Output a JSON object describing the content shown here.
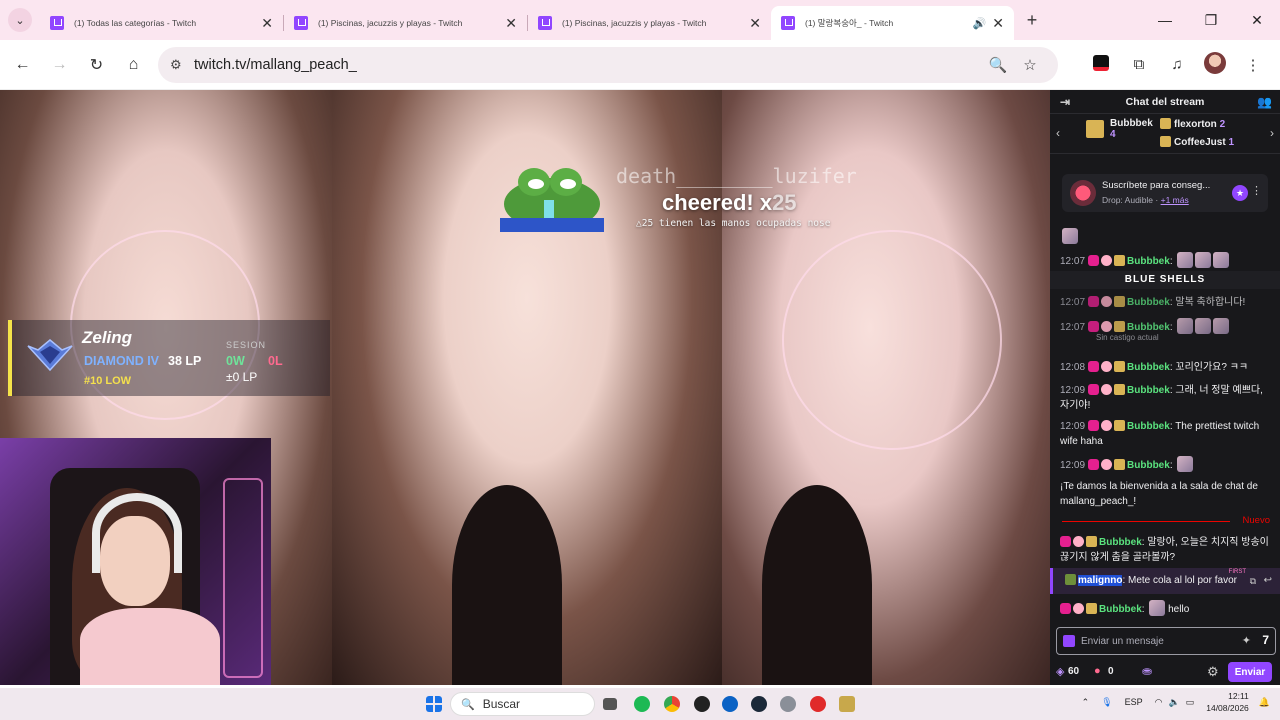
{
  "tabs": [
    {
      "title": "(1) Todas las categorías - Twitch",
      "active": false
    },
    {
      "title": "(1) Piscinas, jacuzzis y playas - Twitch",
      "active": false
    },
    {
      "title": "(1) Piscinas, jacuzzis y playas - Twitch",
      "active": false
    },
    {
      "title": "(1) 말랑복숭아_ - Twitch",
      "active": true
    }
  ],
  "address": {
    "url": "twitch.tv/mallang_peach_"
  },
  "overlay": {
    "cheer_user": "death________luzifer",
    "cheer_text": "cheered! x",
    "cheer_count": "25",
    "cheer_message": "△25 tienen las manos ocupadas nose"
  },
  "rank": {
    "name": "Zeling",
    "tier": "DIAMOND IV",
    "lp": "38 LP",
    "position": "#10 LOW",
    "session_label": "SESION",
    "wins": "0W",
    "losses": "0L",
    "delta_lp": "±0 LP"
  },
  "chat": {
    "header": "Chat del stream",
    "gifters": [
      {
        "name": "Bubbbek",
        "count": "4"
      },
      {
        "name": "flexorton",
        "count": "2"
      },
      {
        "name": "CoffeeJust",
        "count": "1"
      }
    ],
    "sub_card": {
      "title": "Suscríbete para conseg...",
      "drop": "Drop: Audible",
      "more": "+1 más"
    },
    "blue_shells": "BLUE SHELLS",
    "ghost_text": "Sin castigo actual",
    "messages": [
      {
        "time": "12:07",
        "user": "Bubbbek",
        "text": ""
      },
      {
        "time": "12:07",
        "user": "Bubbbek",
        "text": "말복 축하합니다!"
      },
      {
        "time": "12:07",
        "user": "Bubbbek",
        "text": ""
      },
      {
        "time": "12:08",
        "user": "Bubbbek",
        "text": "꼬리인가요? ㅋㅋ"
      },
      {
        "time": "12:09",
        "user": "Bubbbek",
        "text": "그래, 너 정말 예쁘다, 자기야!"
      },
      {
        "time": "12:09",
        "user": "Bubbbek",
        "text": "The prettiest twitch wife haha"
      },
      {
        "time": "12:09",
        "user": "Bubbbek",
        "text": ""
      }
    ],
    "welcome": "¡Te damos la bienvenida a la sala de chat de mallang_peach_!",
    "new_label": "Nuevo",
    "recent": [
      {
        "user": "Bubbbek",
        "text": "말랑아, 오늘은 치지직 방송이 끊기지 않게 춤을 골라볼까?"
      },
      {
        "user": "malignno",
        "text": "Mete cola al lol por favor"
      },
      {
        "user": "Bubbbek",
        "text": "hello"
      }
    ],
    "first_tag": "FIRST",
    "input_placeholder": "Enviar un mensaje",
    "points": "60",
    "bits": "0",
    "send_label": "Enviar"
  },
  "taskbar": {
    "search_label": "Buscar",
    "lang": "ESP",
    "time": "12:11",
    "date": "14/08/2026"
  }
}
